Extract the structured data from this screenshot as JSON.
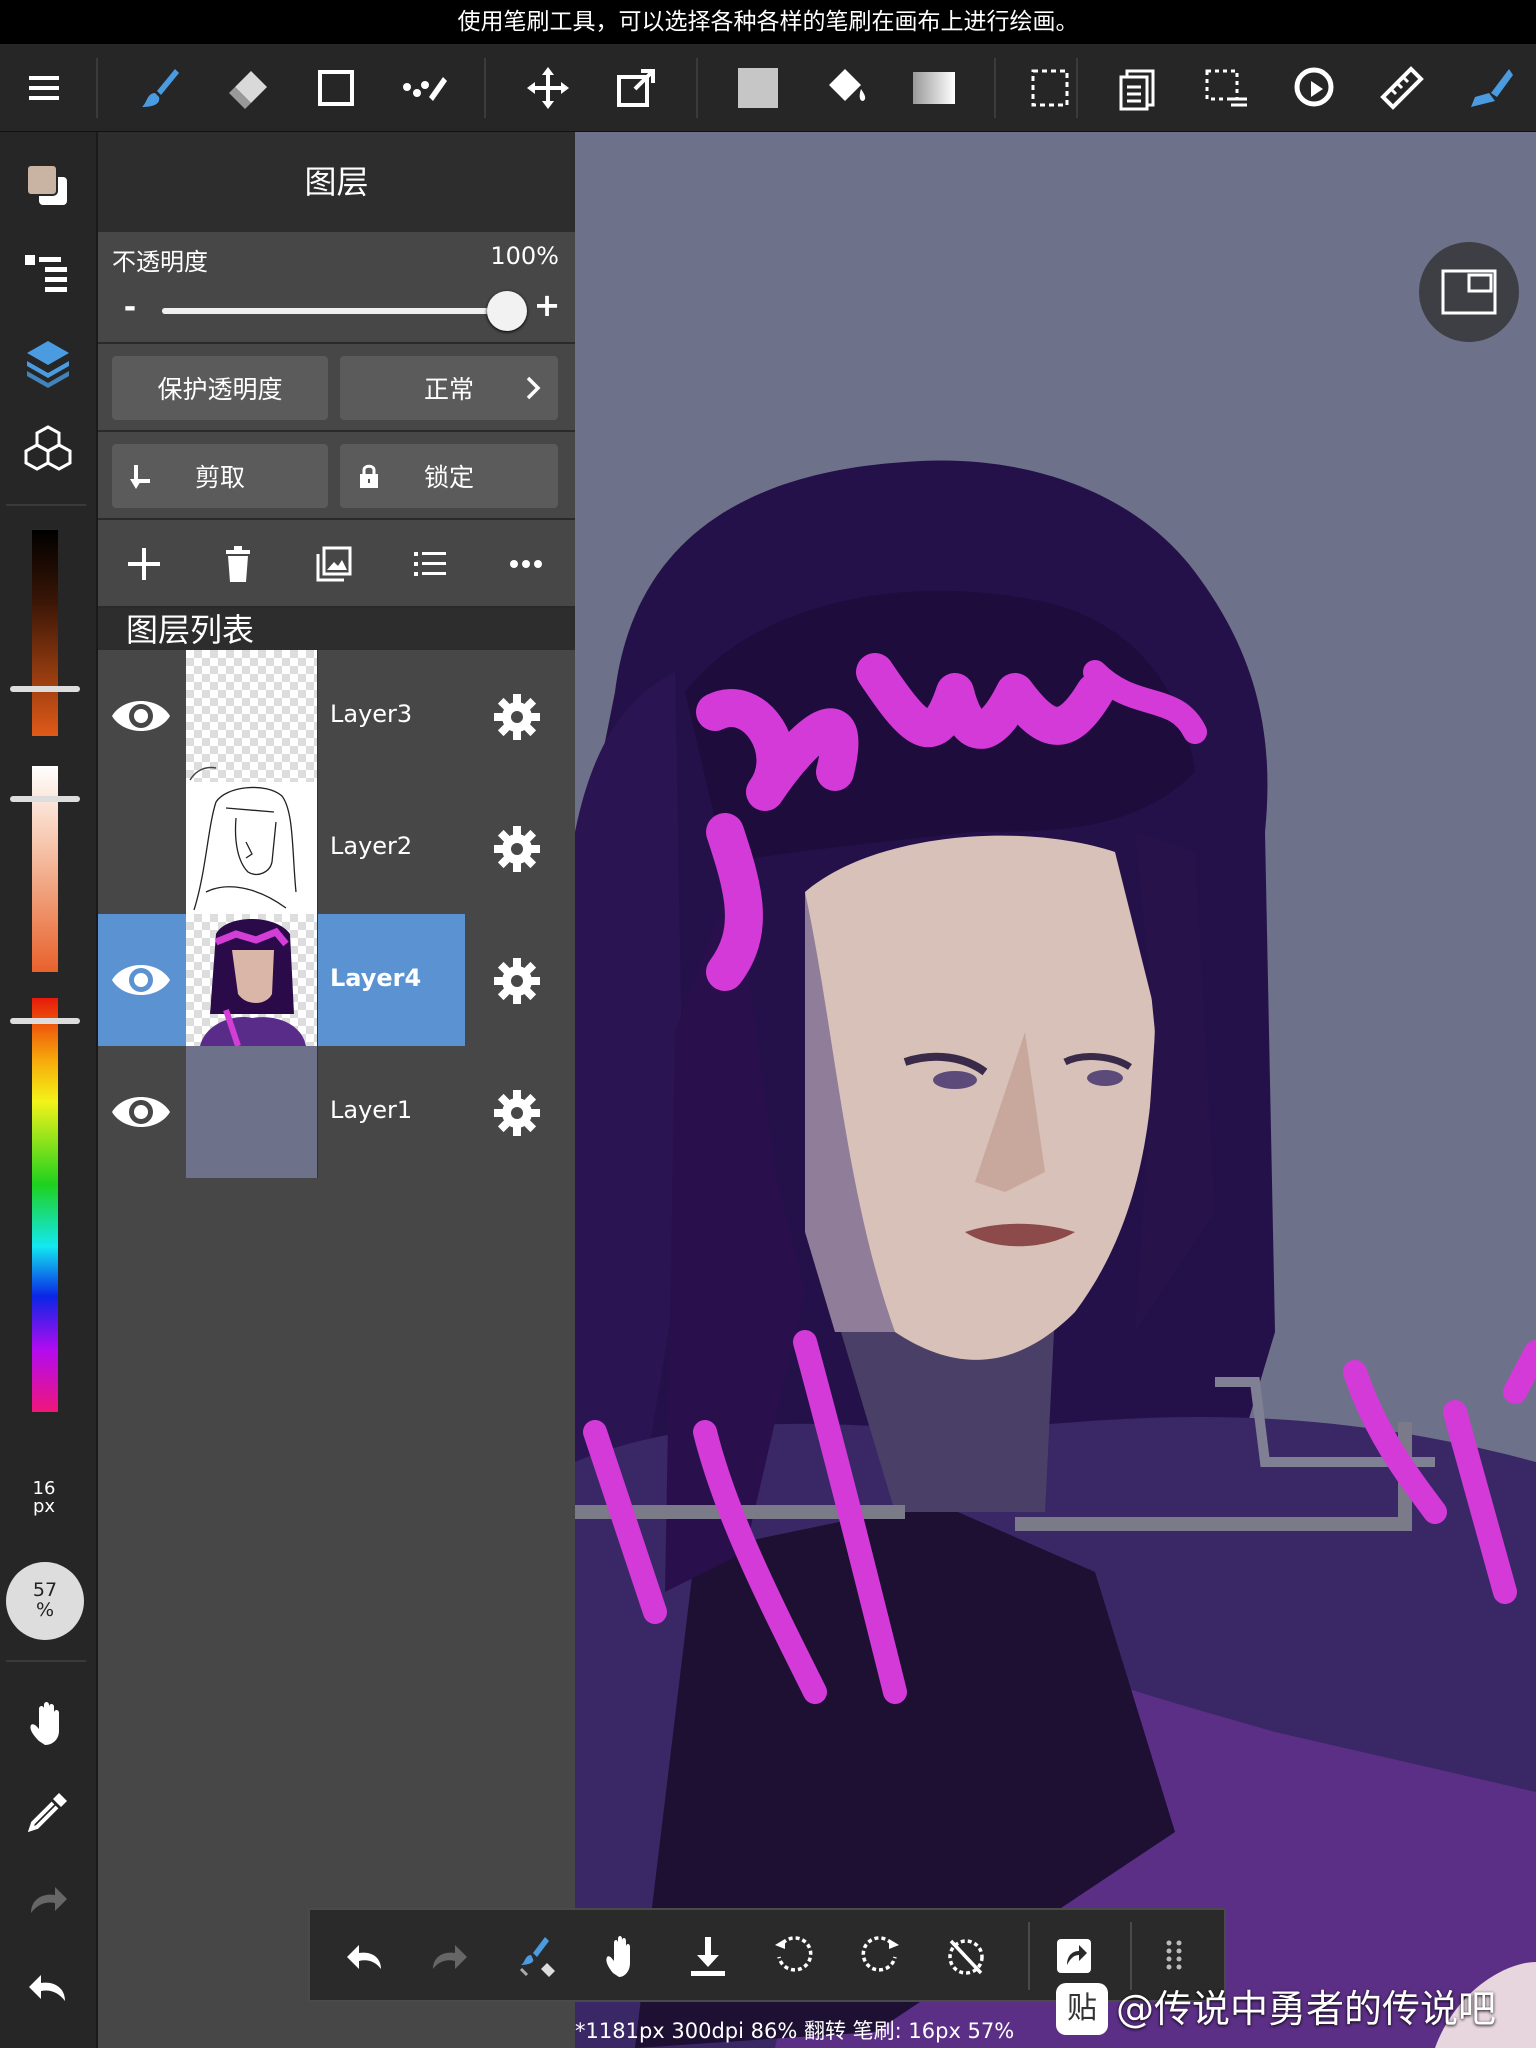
{
  "hint": "使用笔刷工具，可以选择各种各样的笔刷在画布上进行绘画。",
  "toolbar": {
    "icons": [
      "menu-icon",
      "brush-icon",
      "eraser-icon",
      "rectangle-icon",
      "dot-tool-icon",
      "move-icon",
      "transform-icon",
      "fill-color-swatch-icon",
      "bucket-icon",
      "gradient-icon",
      "select-rect-icon",
      "copy-layer-icon",
      "select-options-icon",
      "lasso-icon",
      "ruler-icon",
      "pen-icon"
    ],
    "accent": "#4a9be0"
  },
  "leftbar": {
    "brush_size": "16",
    "brush_size_unit": "px",
    "opacity_value": "57",
    "opacity_unit": "%",
    "color_picker_levels": {
      "dark_orange": 0.83,
      "light": 0.12,
      "hue": 0.05
    }
  },
  "panel": {
    "title": "图层",
    "opacity_label": "不透明度",
    "opacity_value": "100%",
    "opacity_fraction": 1.0,
    "minus": "-",
    "plus": "+",
    "protect_alpha": "保护透明度",
    "blend_mode": "正常",
    "clipping": "剪取",
    "lock": "锁定",
    "list_header": "图层列表",
    "layers": [
      {
        "name": "Layer3",
        "visible": true,
        "selected": false
      },
      {
        "name": "Layer2",
        "visible": false,
        "selected": false
      },
      {
        "name": "Layer4",
        "visible": true,
        "selected": true
      },
      {
        "name": "Layer1",
        "visible": true,
        "selected": false
      }
    ]
  },
  "status": "*1181px 300dpi 86% 翻转 笔刷: 16px 57%",
  "watermark": "@传说中勇者的传说吧",
  "watermark_logo": "贴",
  "colors": {
    "canvas_bg": "#6d7189",
    "selected_layer": "#5b93d2",
    "magenta": "#d43ad8"
  }
}
